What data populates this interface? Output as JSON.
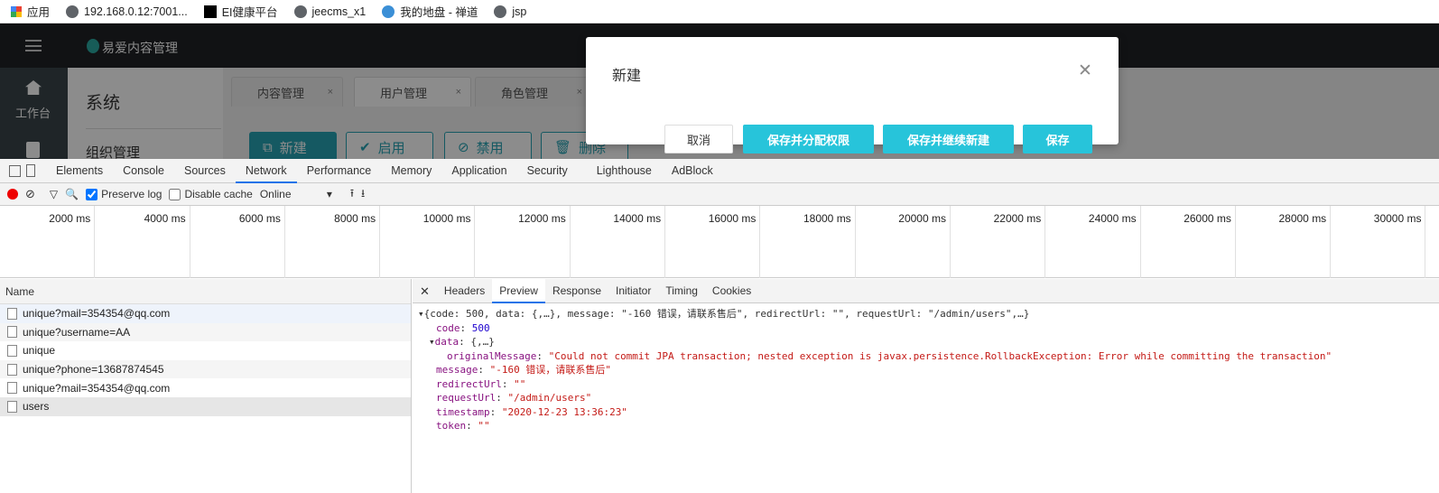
{
  "bookmarks": [
    "应用",
    "192.168.0.12:7001...",
    "EI健康平台",
    "jeecms_x1",
    "我的地盘 - 禅道",
    "jsp"
  ],
  "app": {
    "brand": "易爱内容管理",
    "nav_home": "工作台",
    "section_title": "系统",
    "section_item": "组织管理",
    "tabs": [
      {
        "label": "内容管理"
      },
      {
        "label": "用户管理"
      },
      {
        "label": "角色管理"
      }
    ],
    "close": "×",
    "actions": [
      "新建",
      "启用",
      "禁用",
      "删除"
    ]
  },
  "modal": {
    "title": "新建",
    "close": "✕",
    "buttons": [
      "取消",
      "保存并分配权限",
      "保存并继续新建",
      "保存"
    ],
    "accent": "#27c4da"
  },
  "devtools": {
    "tabs": [
      "Elements",
      "Console",
      "Sources",
      "Network",
      "Performance",
      "Memory",
      "Application",
      "Security",
      "Lighthouse",
      "AdBlock"
    ],
    "preserve_log": "Preserve log",
    "disable_cache": "Disable cache",
    "throttle": "Online",
    "timeline": [
      "2000 ms",
      "4000 ms",
      "6000 ms",
      "8000 ms",
      "10000 ms",
      "12000 ms",
      "14000 ms",
      "16000 ms",
      "18000 ms",
      "20000 ms",
      "22000 ms",
      "24000 ms",
      "26000 ms",
      "28000 ms",
      "30000 ms"
    ],
    "list_header": "Name",
    "requests": [
      "unique?mail=354354@qq.com",
      "unique?username=AA",
      "unique",
      "unique?phone=13687874545",
      "unique?mail=354354@qq.com",
      "users"
    ],
    "panel_tabs": [
      "Headers",
      "Preview",
      "Response",
      "Initiator",
      "Timing",
      "Cookies"
    ],
    "preview": {
      "summary": "{code: 500, data: {,…}, message: \"-160 错误，请联系售后\", redirectUrl: \"\", requestUrl: \"/admin/users\",…}",
      "code_key": "code",
      "code_val": "500",
      "data_key": "data",
      "data_val": "{,…}",
      "om_key": "originalMessage",
      "om_val": "\"Could not commit JPA transaction; nested exception is javax.persistence.RollbackException: Error while committing the transaction\"",
      "msg_key": "message",
      "msg_val": "\"-160 错误，请联系售后\"",
      "redir_key": "redirectUrl",
      "redir_val": "\"\"",
      "req_key": "requestUrl",
      "req_val": "\"/admin/users\"",
      "ts_key": "timestamp",
      "ts_val": "\"2020-12-23 13:36:23\"",
      "tok_key": "token",
      "tok_val": "\"\""
    }
  }
}
